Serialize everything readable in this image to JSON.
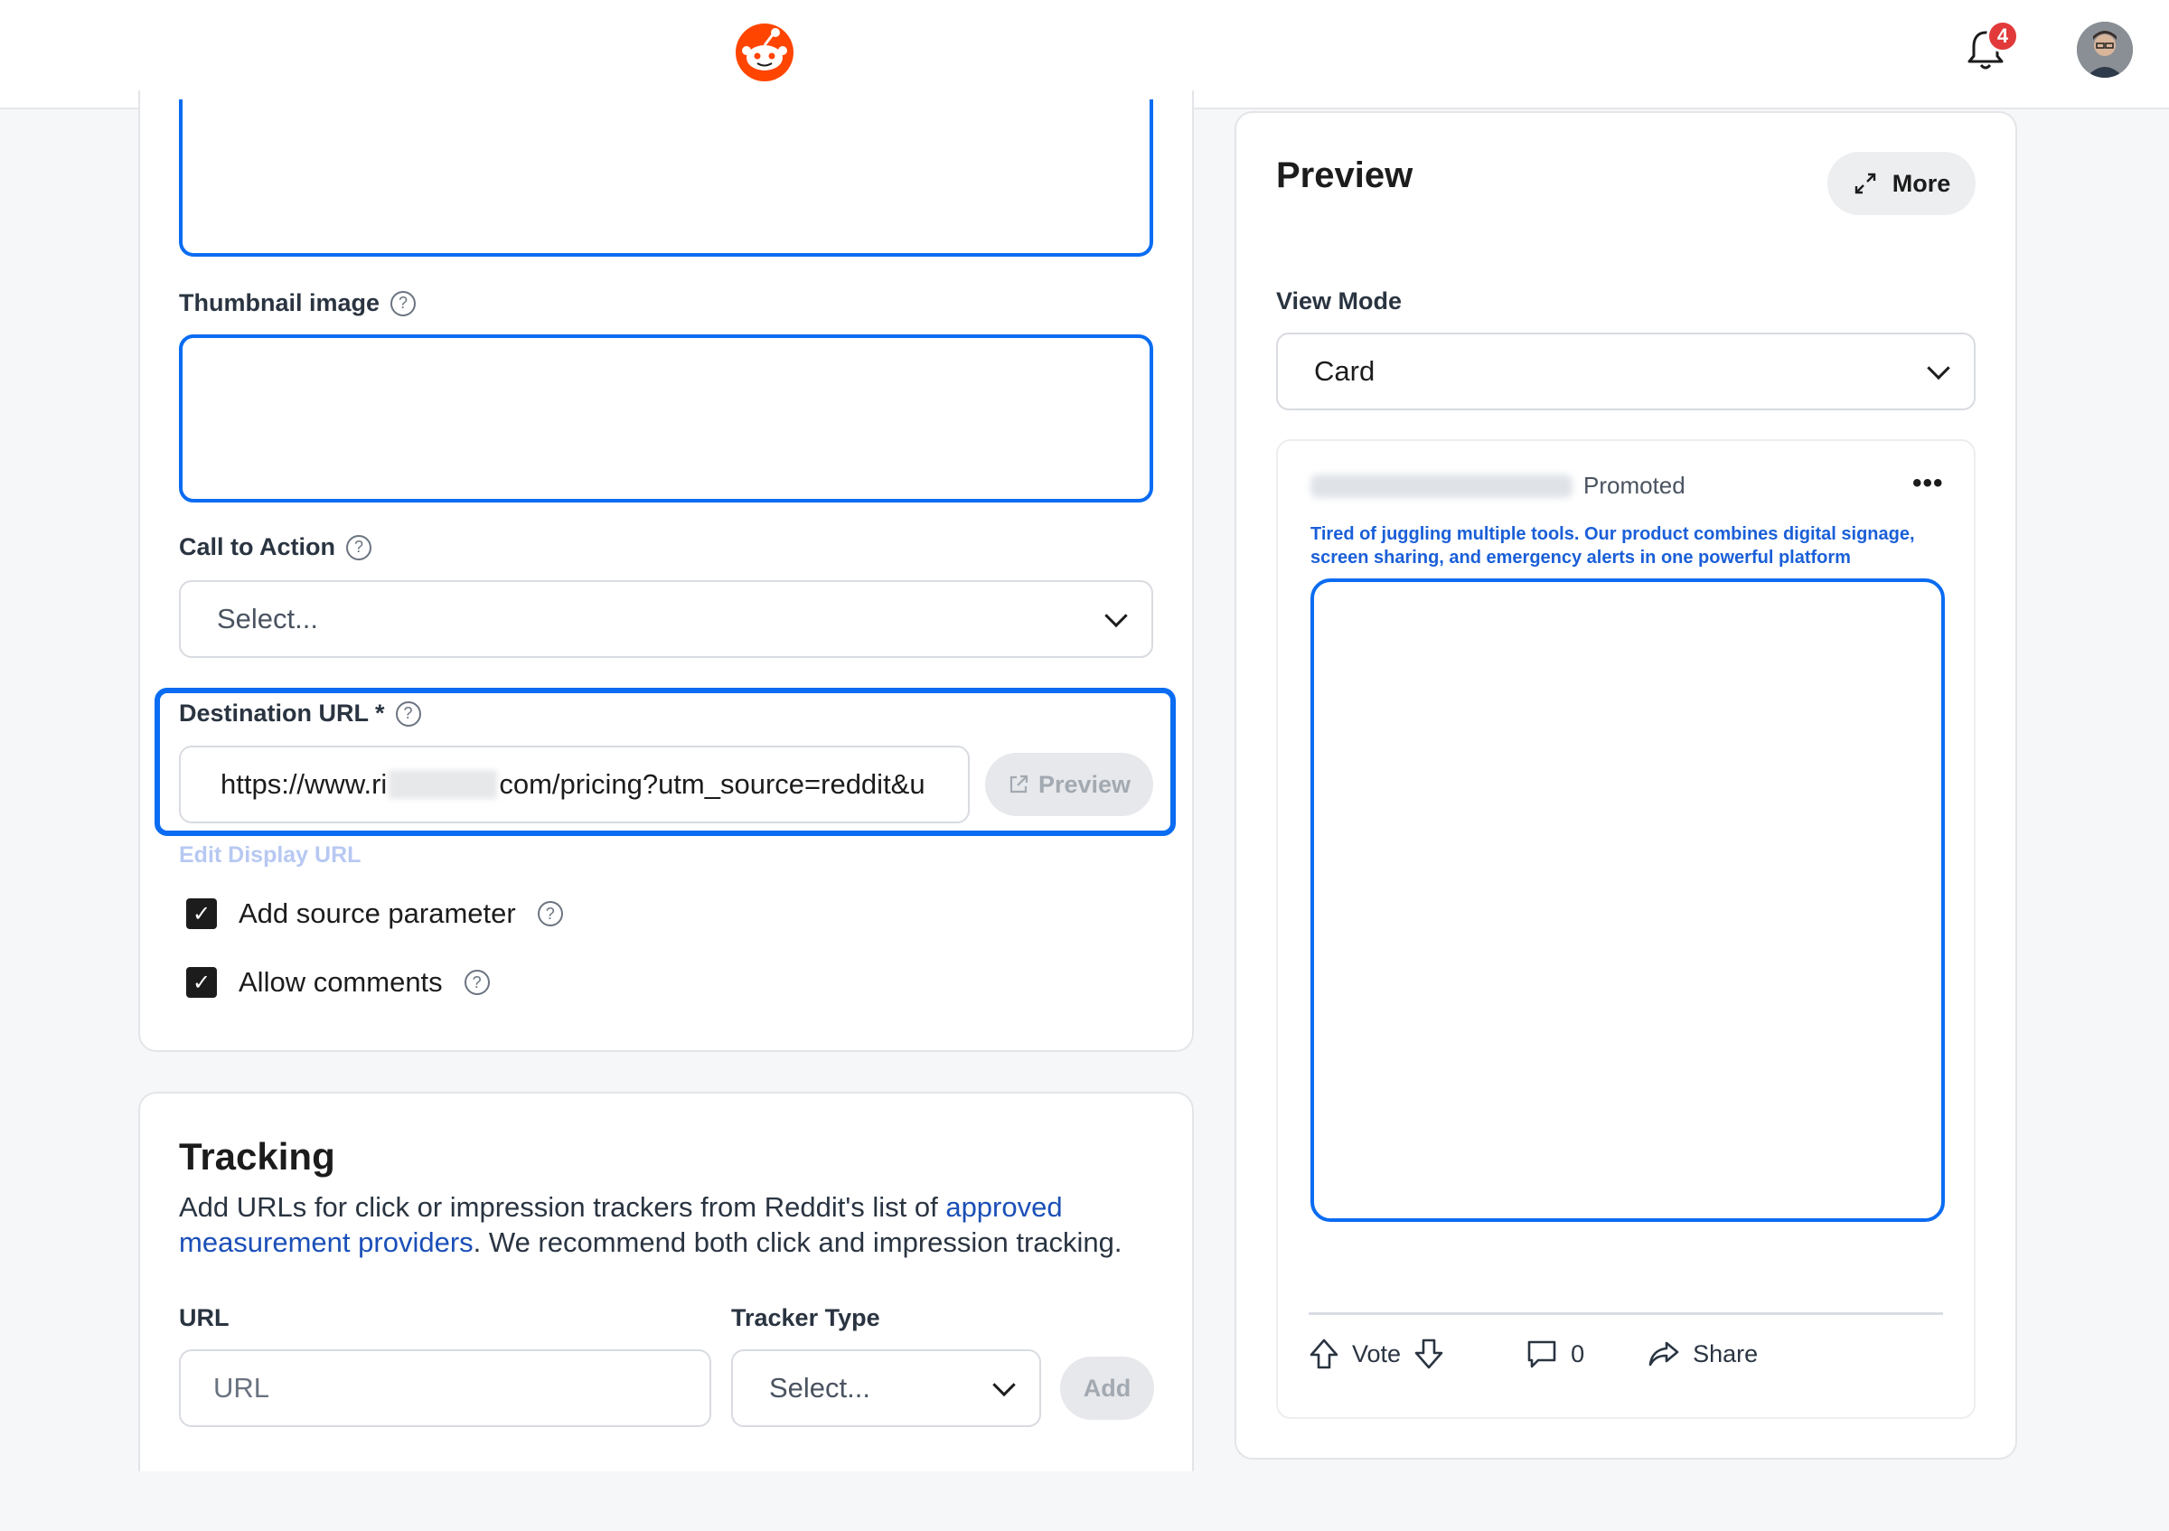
{
  "header": {
    "notification_count": "4",
    "brand_color": "#ff4500"
  },
  "form": {
    "thumbnail_label": "Thumbnail image",
    "cta_label": "Call to Action",
    "cta_value": "Select...",
    "destination_label": "Destination URL *",
    "destination_url_prefix": "https://www.ri",
    "destination_url_suffix": "com/pricing?utm_source=reddit&u",
    "preview_button": "Preview",
    "edit_display_url": "Edit Display URL",
    "add_source_parameter": "Add source parameter",
    "allow_comments": "Allow comments"
  },
  "tracking": {
    "title": "Tracking",
    "description_start": "Add URLs for click or impression trackers from Reddit's list of ",
    "description_link": "approved measurement providers",
    "description_end": ". We recommend both click and impression tracking.",
    "url_label": "URL",
    "url_placeholder": "URL",
    "tracker_type_label": "Tracker Type",
    "tracker_type_value": "Select...",
    "add_button": "Add"
  },
  "preview": {
    "title": "Preview",
    "more_button": "More",
    "view_mode_label": "View Mode",
    "view_mode_value": "Card",
    "post": {
      "promoted_label": "Promoted",
      "ad_text": "Tired of juggling multiple tools. Our product combines digital signage, screen sharing, and emergency alerts in one powerful platform",
      "vote_label": "Vote",
      "comment_count": "0",
      "share_label": "Share"
    }
  }
}
